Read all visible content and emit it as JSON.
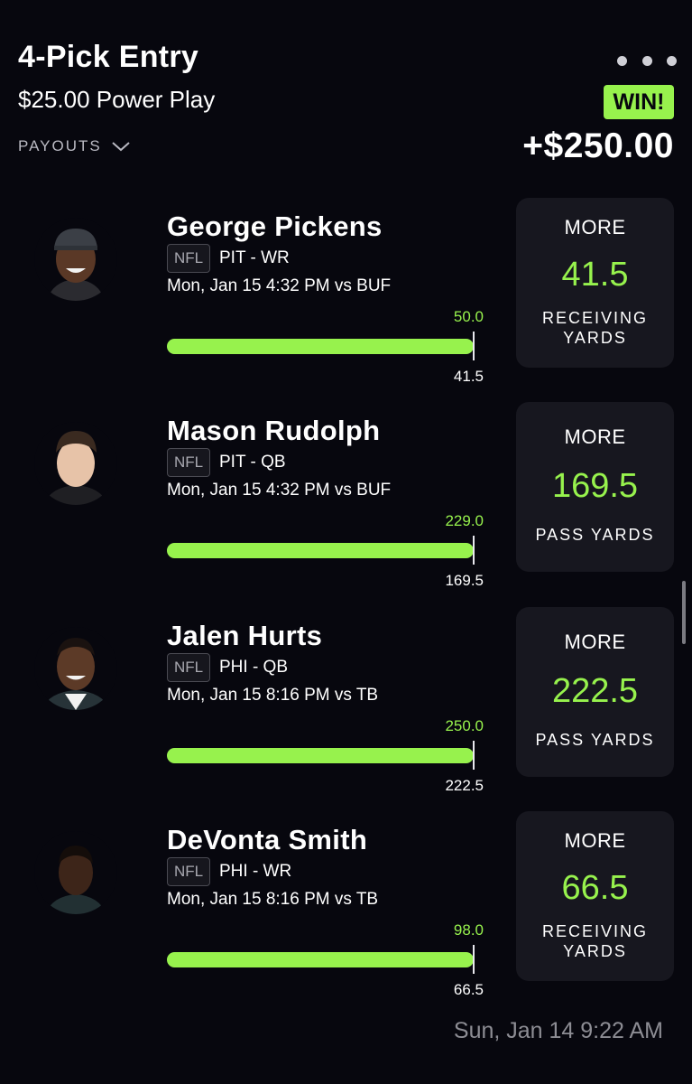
{
  "header": {
    "title": "4-Pick Entry",
    "subtitle": "$25.00 Power Play",
    "payouts_label": "PAYOUTS",
    "status_badge": "WIN!",
    "win_amount": "+$250.00",
    "more_menu_icon": "more-dots-icon"
  },
  "colors": {
    "background": "#07070e",
    "accent_green": "#97f24d",
    "card": "#17171f"
  },
  "picks": [
    {
      "player": "George Pickens",
      "league": "NFL",
      "team_position": "PIT - WR",
      "game": "Mon, Jan 15 4:32 PM  vs BUF",
      "actual": "50.0",
      "line": "41.5",
      "progress": 1.0,
      "direction": "MORE",
      "projection": "41.5",
      "stat": "RECEIVING YARDS"
    },
    {
      "player": "Mason Rudolph",
      "league": "NFL",
      "team_position": "PIT - QB",
      "game": "Mon, Jan 15 4:32 PM  vs BUF",
      "actual": "229.0",
      "line": "169.5",
      "progress": 1.0,
      "direction": "MORE",
      "projection": "169.5",
      "stat": "PASS YARDS"
    },
    {
      "player": "Jalen Hurts",
      "league": "NFL",
      "team_position": "PHI - QB",
      "game": "Mon, Jan 15 8:16 PM  vs TB",
      "actual": "250.0",
      "line": "222.5",
      "progress": 1.0,
      "direction": "MORE",
      "projection": "222.5",
      "stat": "PASS YARDS"
    },
    {
      "player": "DeVonta Smith",
      "league": "NFL",
      "team_position": "PHI - WR",
      "game": "Mon, Jan 15 8:16 PM  vs TB",
      "actual": "98.0",
      "line": "66.5",
      "progress": 1.0,
      "direction": "MORE",
      "projection": "66.5",
      "stat": "RECEIVING YARDS"
    }
  ],
  "footer": {
    "timestamp": "Sun, Jan 14 9:22 AM"
  }
}
